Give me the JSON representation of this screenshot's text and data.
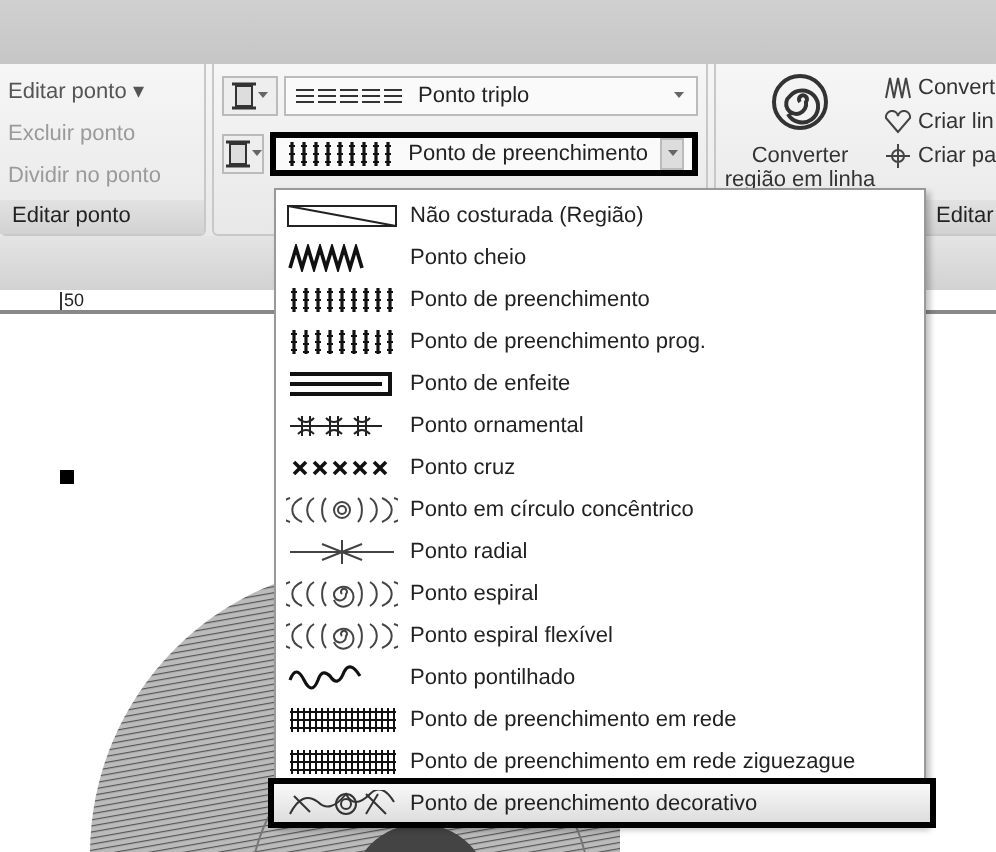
{
  "ribbon": {
    "groups": [
      {
        "kind": "edit",
        "items": [
          {
            "label": "Editar ponto",
            "caret": "▾",
            "disabled": false
          },
          {
            "label": "Excluir ponto",
            "disabled": true
          },
          {
            "label": "Dividir no ponto",
            "disabled": true
          }
        ],
        "label": "Editar ponto"
      },
      {
        "kind": "combos",
        "combos": [
          {
            "kind": "triple",
            "value": "Ponto triplo",
            "highlighted": false
          },
          {
            "kind": "fill",
            "value": "Ponto de preenchimento",
            "highlighted": true
          }
        ]
      },
      {
        "kind": "convert",
        "big_button": [
          "Converter",
          "região em linha"
        ],
        "items": [
          "Convert",
          "Criar lin",
          "Criar pa"
        ],
        "label": "Editar"
      }
    ]
  },
  "ruler": {
    "label": "50"
  },
  "menu": {
    "items": [
      {
        "kind": "region",
        "label": "Não costurada (Região)",
        "selected": false
      },
      {
        "kind": "satin",
        "label": "Ponto cheio",
        "selected": false
      },
      {
        "kind": "fill",
        "label": "Ponto de preenchimento",
        "selected": false
      },
      {
        "kind": "progfill",
        "label": "Ponto de preenchimento prog.",
        "selected": false
      },
      {
        "kind": "bar",
        "label": "Ponto de enfeite",
        "selected": false
      },
      {
        "kind": "motif",
        "label": "Ponto ornamental",
        "selected": false
      },
      {
        "kind": "cross",
        "label": "Ponto cruz",
        "selected": false
      },
      {
        "kind": "concentric",
        "label": "Ponto em círculo concêntrico",
        "selected": false
      },
      {
        "kind": "radial",
        "label": "Ponto radial",
        "selected": false
      },
      {
        "kind": "spiral",
        "label": "Ponto espiral",
        "selected": false
      },
      {
        "kind": "spiral",
        "label": "Ponto espiral flexível",
        "selected": false
      },
      {
        "kind": "stipple",
        "label": "Ponto pontilhado",
        "selected": false
      },
      {
        "kind": "net",
        "label": "Ponto de preenchimento em rede",
        "selected": false
      },
      {
        "kind": "net",
        "label": "Ponto de preenchimento em rede ziguezague",
        "selected": false
      },
      {
        "kind": "decorative",
        "label": "Ponto de preenchimento decorativo",
        "selected": true
      }
    ]
  }
}
